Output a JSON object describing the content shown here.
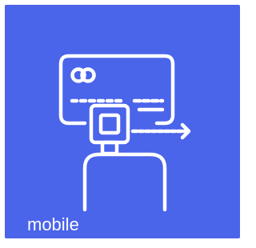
{
  "tile": {
    "label": "mobile",
    "background_color": "#4a64ea",
    "foreground_color": "#ffffff",
    "icon": "card-reader-mobile-icon"
  }
}
